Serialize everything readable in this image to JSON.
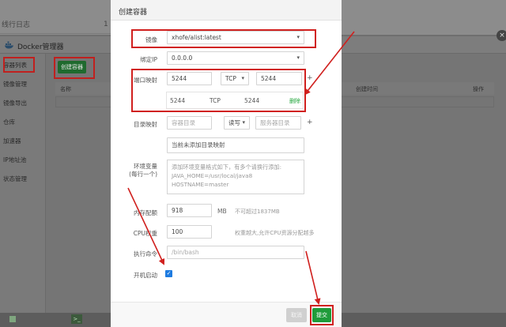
{
  "background": {
    "top_text": "线行日志",
    "top_number": "1",
    "window_title": "Docker管理器",
    "sidebar": [
      "容器列表",
      "镜像管理",
      "镜像导出",
      "仓库",
      "加速器",
      "IP地址池",
      "状态管理"
    ],
    "create_button": "创建容器",
    "table_headers": [
      "名称",
      "创建时间",
      "操作"
    ],
    "close_glyph": "×"
  },
  "modal": {
    "title": "创建容器",
    "image": {
      "label": "镜像",
      "value": "xhofe/alist:latest"
    },
    "bind_ip": {
      "label": "绑定IP",
      "value": "0.0.0.0"
    },
    "port_map": {
      "label": "端口映射",
      "container_port": "5244",
      "protocol": "TCP",
      "host_port": "5244",
      "add_glyph": "+",
      "row": {
        "container_port": "5244",
        "protocol": "TCP",
        "host_port": "5244",
        "delete_label": "删除"
      }
    },
    "dir_map": {
      "label": "目录映射",
      "container_dir_placeholder": "容器目录",
      "permission": "读写",
      "host_dir_placeholder": "服务器目录",
      "add_glyph": "+",
      "empty_text": "当前未添加目录映射"
    },
    "env": {
      "label_line1": "环境变量",
      "label_line2": "(每行一个)",
      "lines": [
        "添加环境变量格式如下，有多个请换行添加:",
        "JAVA_HOME=/usr/local/java8",
        "HOSTNAME=master"
      ]
    },
    "memory": {
      "label": "内存配额",
      "value": "918",
      "unit": "MB",
      "hint": "不可超过1837MB"
    },
    "cpu": {
      "label": "CPU权重",
      "value": "100",
      "hint": "权重越大,允许CPU资源分配越多"
    },
    "command": {
      "label": "执行命令",
      "placeholder": "/bin/bash"
    },
    "autostart": {
      "label": "开机启动",
      "checked": true,
      "check_glyph": "✓"
    },
    "cancel_label": "取消",
    "submit_label": "提交"
  },
  "colors": {
    "accent_green": "#20a53a",
    "annotation_red": "#d0201e",
    "checkbox_blue": "#1e7be0"
  }
}
